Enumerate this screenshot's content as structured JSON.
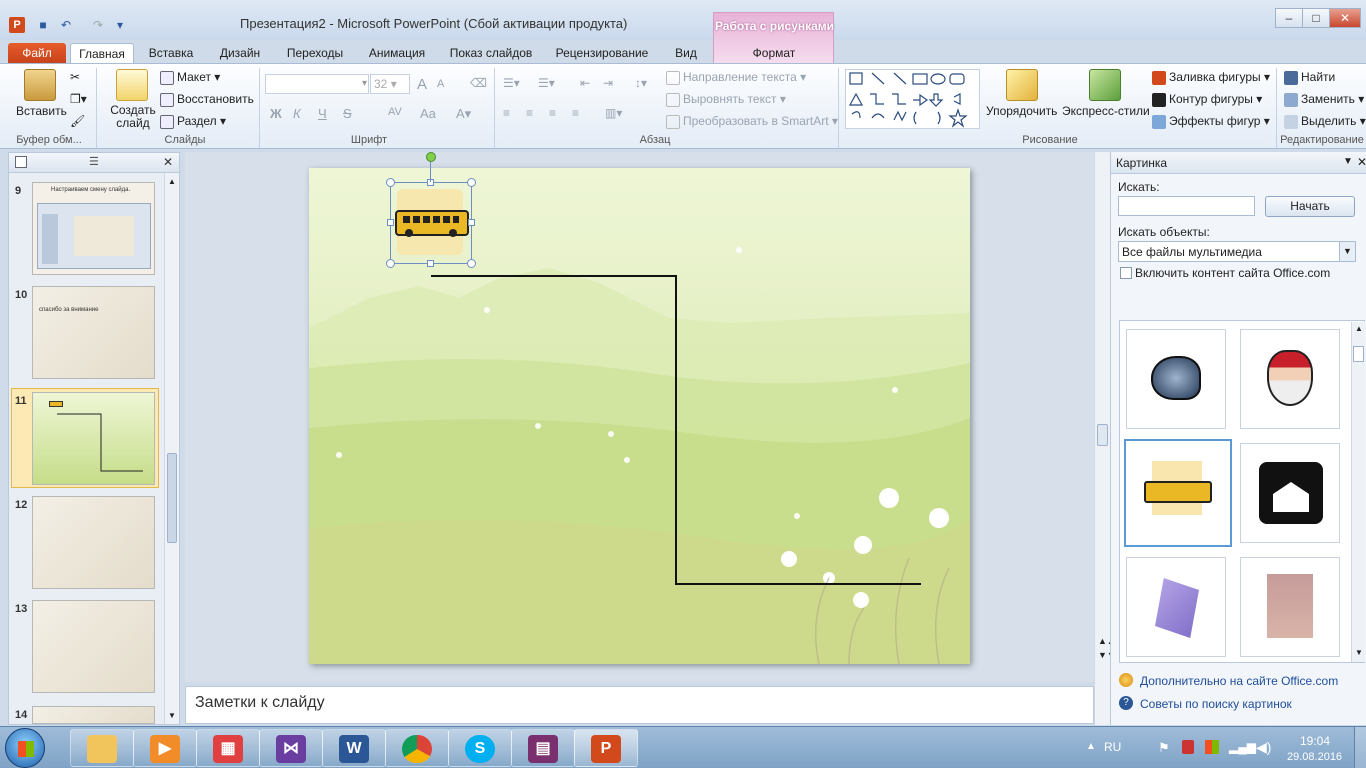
{
  "window": {
    "title": "Презентация2 - Microsoft PowerPoint (Сбой активации продукта)",
    "context_tab_group": "Работа с рисунками",
    "min": "–",
    "max": "□",
    "close": "✕"
  },
  "tabs": [
    "Файл",
    "Главная",
    "Вставка",
    "Дизайн",
    "Переходы",
    "Анимация",
    "Показ слайдов",
    "Рецензирование",
    "Вид",
    "Формат"
  ],
  "ribbon": {
    "clipboard": {
      "paste": "Вставить",
      "label": "Буфер обм..."
    },
    "slides": {
      "new_slide": "Создать слайд",
      "layout": "Макет",
      "reset": "Восстановить",
      "section": "Раздел",
      "label": "Слайды"
    },
    "font": {
      "size": "32",
      "bold": "Ж",
      "italic": "К",
      "underline": "Ч",
      "strike": "S",
      "spacing": "AV",
      "case": "Aa",
      "grow": "A",
      "shrink": "A",
      "label": "Шрифт"
    },
    "paragraph": {
      "text_dir": "Направление текста",
      "align_text": "Выровнять текст",
      "smartart": "Преобразовать в SmartArt",
      "label": "Абзац"
    },
    "drawing": {
      "arrange": "Упорядочить",
      "quick_styles": "Экспресс-стили",
      "fill": "Заливка фигуры",
      "outline": "Контур фигуры",
      "effects": "Эффекты фигур",
      "label": "Рисование"
    },
    "editing": {
      "find": "Найти",
      "replace": "Заменить",
      "select": "Выделить",
      "label": "Редактирование"
    }
  },
  "slides_panel": {
    "items": [
      {
        "num": "9",
        "caption": "Настраиваем смену слайда."
      },
      {
        "num": "10",
        "caption": "спасибо за внимание"
      },
      {
        "num": "11",
        "caption": ""
      },
      {
        "num": "12",
        "caption": ""
      },
      {
        "num": "13",
        "caption": ""
      },
      {
        "num": "14",
        "caption": ""
      }
    ],
    "close": "✕"
  },
  "notes": {
    "placeholder": "Заметки к слайду"
  },
  "clipart_pane": {
    "title": "Картинка",
    "search_label": "Искать:",
    "search_value": "",
    "go_button": "Начать",
    "search_in_label": "Искать объекты:",
    "media_type": "Все файлы мультимедиа",
    "office_checkbox": "Включить контент сайта Office.com",
    "more_link": "Дополнительно на сайте Office.com",
    "tips_link": "Советы по поиску картинок",
    "items": [
      "football-helmet",
      "santa-claus",
      "school-bus",
      "house",
      "caduceus",
      "woman-shopping"
    ]
  },
  "taskbar": {
    "apps": [
      "Проводник",
      "Windows Media Player",
      "Приложения",
      "Visual Studio",
      "Microsoft Word",
      "Google Chrome",
      "Skype",
      "WinRAR",
      "Microsoft PowerPoint"
    ],
    "lang": "RU",
    "time": "19:04",
    "date": "29.08.2016"
  },
  "colors": {
    "accent": "#2b5797",
    "file_tab": "#d24a1c",
    "context_tab": "#e7b3d8",
    "selection": "#f7d27a"
  }
}
